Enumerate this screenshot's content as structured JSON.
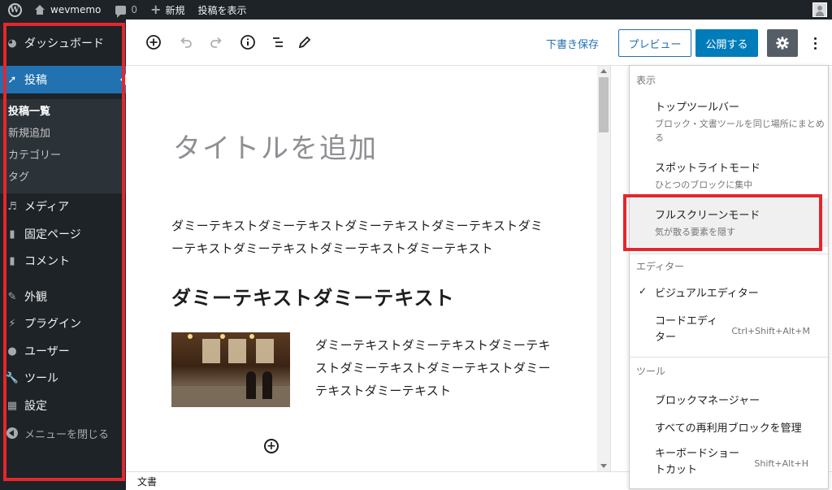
{
  "admin_bar": {
    "site_name": "wevmemo",
    "comment_count": "0",
    "new_label": "新規",
    "view_post_label": "投稿を表示"
  },
  "sidebar": {
    "items": [
      {
        "label": "ダッシュボード",
        "icon": "dashboard-icon"
      },
      {
        "label": "投稿",
        "icon": "pin-icon"
      },
      {
        "label": "メディア",
        "icon": "media-icon"
      },
      {
        "label": "固定ページ",
        "icon": "page-icon"
      },
      {
        "label": "コメント",
        "icon": "comment-icon"
      },
      {
        "label": "外観",
        "icon": "brush-icon"
      },
      {
        "label": "プラグイン",
        "icon": "plugin-icon"
      },
      {
        "label": "ユーザー",
        "icon": "user-icon"
      },
      {
        "label": "ツール",
        "icon": "wrench-icon"
      },
      {
        "label": "設定",
        "icon": "settings-icon"
      }
    ],
    "submenu": [
      "投稿一覧",
      "新規追加",
      "カテゴリー",
      "タグ"
    ],
    "collapse_label": "メニューを閉じる"
  },
  "toolbar": {
    "save_draft": "下書き保存",
    "preview": "プレビュー",
    "publish": "公開する"
  },
  "editor": {
    "title_placeholder": "タイトルを追加",
    "paragraph1": "ダミーテキストダミーテキストダミーテキストダミーテキストダミーテキストダミーテキストダミーテキストダミーテキスト",
    "heading": "ダミーテキストダミーテキスト",
    "paragraph2": "ダミーテキストダミーテキストダミーテキストダミーテキストダミーテキストダミーテキストダミーテキスト"
  },
  "footer": {
    "breadcrumb": "文書"
  },
  "more_menu": {
    "view_group": "表示",
    "top_toolbar": {
      "label": "トップツールバー",
      "desc": "ブロック・文書ツールを同じ場所にまとめる"
    },
    "spotlight": {
      "label": "スポットライトモード",
      "desc": "ひとつのブロックに集中"
    },
    "fullscreen": {
      "label": "フルスクリーンモード",
      "desc": "気が散る要素を隠す"
    },
    "editor_group": "エディター",
    "visual_editor": "ビジュアルエディター",
    "code_editor": {
      "label": "コードエディター",
      "shortcut": "Ctrl+Shift+Alt+M"
    },
    "tools_group": "ツール",
    "block_manager": "ブロックマネージャー",
    "reusable_blocks": "すべての再利用ブロックを管理",
    "keyboard_shortcuts": {
      "label": "キーボードショートカット",
      "shortcut": "Shift+Alt+H"
    }
  },
  "colors": {
    "highlight_border": "#e5262d",
    "admin_dark": "#1d2327",
    "accent": "#2271b1",
    "publish": "#007cba"
  }
}
